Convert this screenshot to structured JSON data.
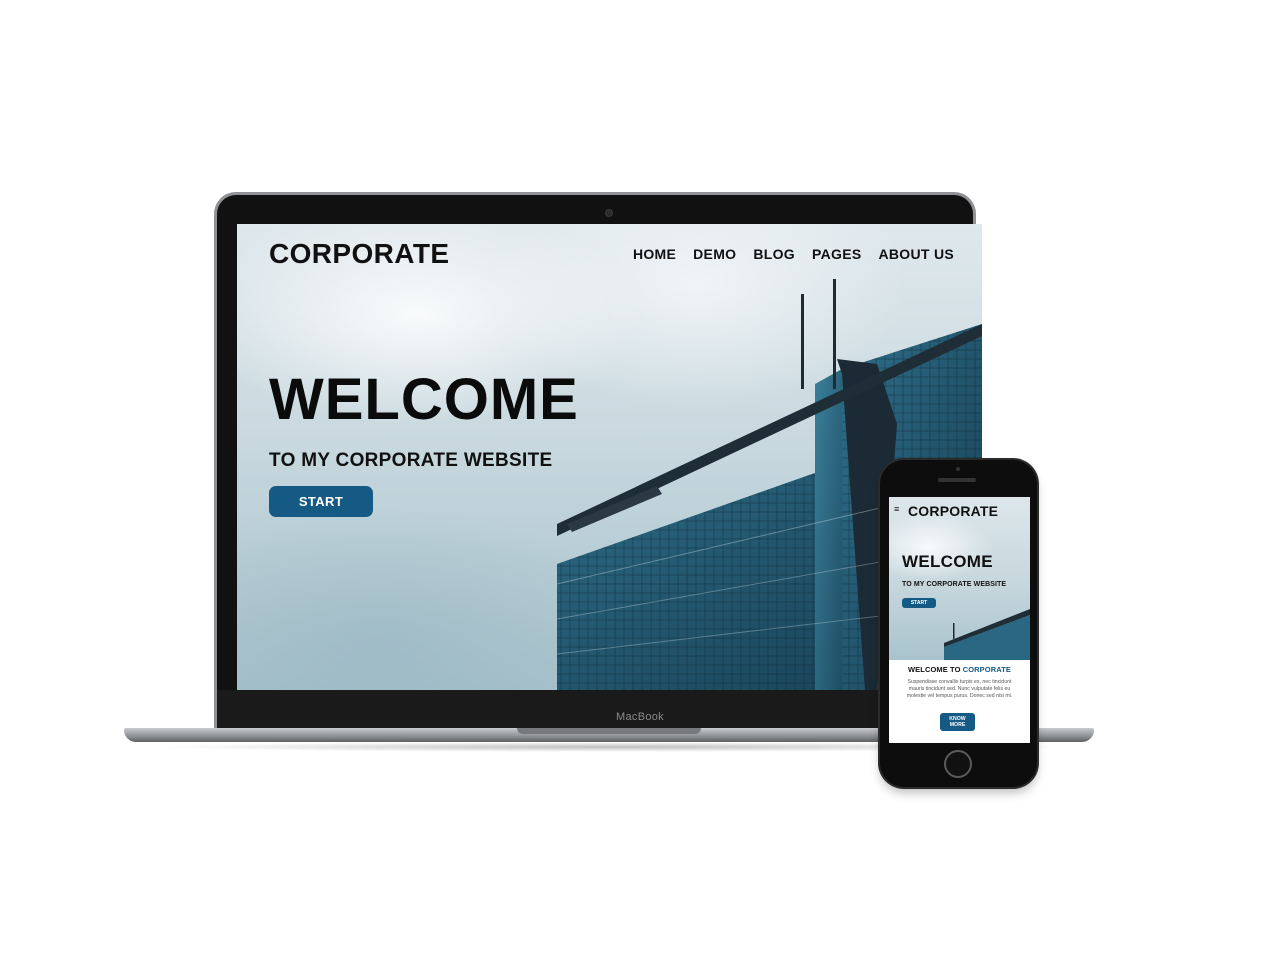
{
  "laptop": {
    "brand_label": "MacBook",
    "site": {
      "logo": "CORPORATE",
      "nav": [
        "HOME",
        "DEMO",
        "BLOG",
        "PAGES",
        "ABOUT US"
      ],
      "hero_title": "WELCOME",
      "hero_subtitle": "TO MY CORPORATE WEBSITE",
      "cta_label": "START"
    }
  },
  "phone": {
    "menu_icon": "≡",
    "logo": "CORPORATE",
    "hero_title": "WELCOME",
    "hero_subtitle": "TO MY CORPORATE WEBSITE",
    "cta_label": "START",
    "section": {
      "title_prefix": "WELCOME TO ",
      "title_accent": "CORPORATE",
      "body": "Suspendisse convallis turpis ex, nec tincidunt mauris tincidunt sed. Nunc vulputate felis eu molestie vel tempus purus. Donec sed nisi mi.",
      "button_line1": "KNOW",
      "button_line2": "MORE"
    }
  },
  "colors": {
    "accent": "#155a84",
    "text": "#111111",
    "background": "#ffffff"
  }
}
